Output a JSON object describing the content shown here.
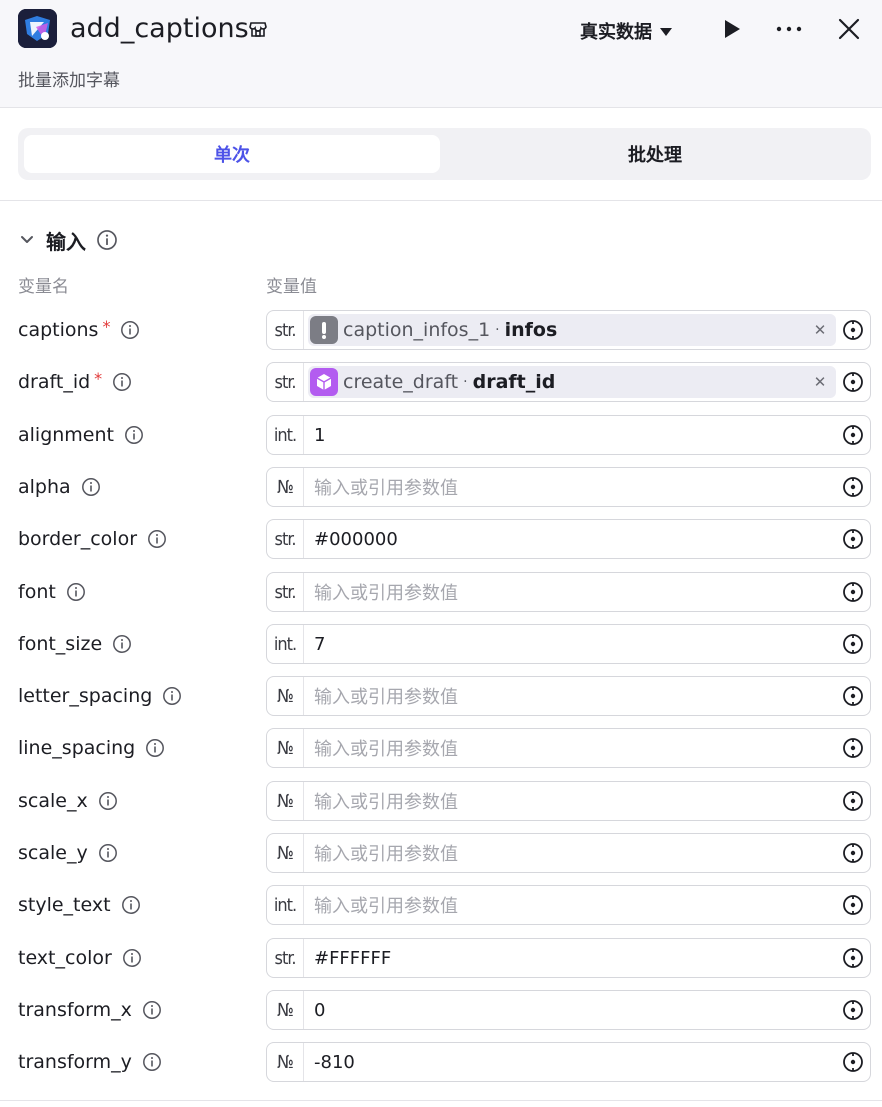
{
  "header": {
    "title": "add_captions",
    "subtitle": "批量添加字幕",
    "data_source_label": "真实数据",
    "icons": {
      "app": "capcut-logo-icon",
      "store": "store-icon",
      "run": "play-icon",
      "more": "more-dots-icon",
      "close": "close-icon"
    }
  },
  "tabs": {
    "single": "单次",
    "batch": "批处理",
    "active": "single"
  },
  "input_section": {
    "title": "输入",
    "col_name": "变量名",
    "col_value": "变量值"
  },
  "params": [
    {
      "name": "captions",
      "required": true,
      "type": "str.",
      "ref": {
        "node": "caption_infos_1",
        "var": "infos",
        "icon": "exclamation-node-icon",
        "color": "#7c7d85"
      }
    },
    {
      "name": "draft_id",
      "required": true,
      "type": "str.",
      "ref": {
        "node": "create_draft",
        "var": "draft_id",
        "icon": "cube-node-icon",
        "color": "#b35cf0"
      }
    },
    {
      "name": "alignment",
      "type": "int.",
      "value": "1"
    },
    {
      "name": "alpha",
      "type": "№",
      "placeholder": "输入或引用参数值"
    },
    {
      "name": "border_color",
      "type": "str.",
      "value": "#000000"
    },
    {
      "name": "font",
      "type": "str.",
      "placeholder": "输入或引用参数值"
    },
    {
      "name": "font_size",
      "type": "int.",
      "value": "7"
    },
    {
      "name": "letter_spacing",
      "type": "№",
      "placeholder": "输入或引用参数值"
    },
    {
      "name": "line_spacing",
      "type": "№",
      "placeholder": "输入或引用参数值"
    },
    {
      "name": "scale_x",
      "type": "№",
      "placeholder": "输入或引用参数值"
    },
    {
      "name": "scale_y",
      "type": "№",
      "placeholder": "输入或引用参数值"
    },
    {
      "name": "style_text",
      "type": "int.",
      "placeholder": "输入或引用参数值"
    },
    {
      "name": "text_color",
      "type": "str.",
      "value": "#FFFFFF"
    },
    {
      "name": "transform_x",
      "type": "№",
      "value": "0"
    },
    {
      "name": "transform_y",
      "type": "№",
      "value": "-810"
    }
  ],
  "colors": {
    "accent": "#4d53e8",
    "required": "#e23a3a",
    "placeholder": "#a6a7ae"
  }
}
